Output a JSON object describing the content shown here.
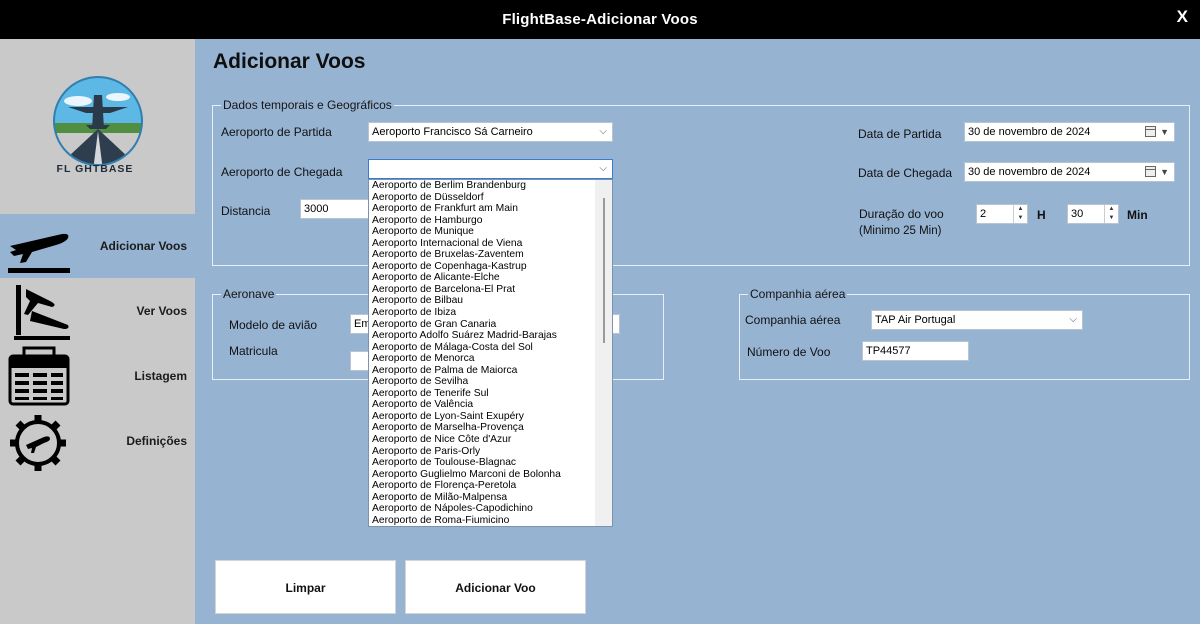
{
  "window": {
    "title": "FlightBase-Adicionar Voos",
    "close_label": "X"
  },
  "sidebar": {
    "logo_text": "FL GHTBASE",
    "items": [
      {
        "label": "Adicionar Voos",
        "icon": "airplane-takeoff-icon",
        "active": true
      },
      {
        "label": "Ver Voos",
        "icon": "airplane-landing-icon",
        "active": false
      },
      {
        "label": "Listagem",
        "icon": "departure-board-icon",
        "active": false
      },
      {
        "label": "Definições",
        "icon": "gear-airplane-icon",
        "active": false
      }
    ]
  },
  "page_title": "Adicionar Voos",
  "geo": {
    "legend": "Dados temporais e Geográficos",
    "departure_airport_label": "Aeroporto de Partida",
    "departure_airport_value": "Aeroporto Francisco Sá Carneiro",
    "arrival_airport_label": "Aeroporto de Chegada",
    "arrival_airport_value": "",
    "distance_label": "Distancia",
    "distance_value": "3000",
    "departure_date_label": "Data de Partida",
    "departure_date_value": "30 de novembro de 2024",
    "arrival_date_label": "Data de Chegada",
    "arrival_date_value": "30 de novembro de 2024",
    "duration_label": "Duração do voo",
    "duration_hint": "(Minimo 25 Min)",
    "duration_hours": "2",
    "hours_unit": "H",
    "duration_minutes": "30",
    "minutes_unit": "Min"
  },
  "aircraft": {
    "legend": "Aeronave",
    "model_label": "Modelo de avião",
    "model_value": "Em",
    "registration_label": "Matricula",
    "registration_value": ""
  },
  "airline": {
    "legend": "Companhia aérea",
    "airline_label": "Companhia aérea",
    "airline_value": "TAP Air Portugal",
    "flight_number_label": "Número de Voo",
    "flight_number_value": "TP44577"
  },
  "dropdown_options": [
    "Aeroporto de Berlim Brandenburg",
    "Aeroporto de Düsseldorf",
    "Aeroporto de Frankfurt am Main",
    "Aeroporto de Hamburgo",
    "Aeroporto de Munique",
    "Aeroporto Internacional de Viena",
    "Aeroporto de Bruxelas-Zaventem",
    "Aeroporto de Copenhaga-Kastrup",
    "Aeroporto de Alicante-Elche",
    "Aeroporto de Barcelona-El Prat",
    "Aeroporto de Bilbau",
    "Aeroporto de Ibiza",
    "Aeroporto de Gran Canaria",
    "Aeroporto Adolfo Suárez Madrid-Barajas",
    "Aeroporto de Málaga-Costa del Sol",
    "Aeroporto de Menorca",
    "Aeroporto de Palma de Maiorca",
    "Aeroporto de Sevilha",
    "Aeroporto de Tenerife Sul",
    "Aeroporto de Valência",
    "Aeroporto de Lyon-Saint Exupéry",
    "Aeroporto de Marselha-Provença",
    "Aeroporto de Nice Côte d'Azur",
    "Aeroporto de Paris-Orly",
    "Aeroporto de Toulouse-Blagnac",
    "Aeroporto Guglielmo Marconi de Bolonha",
    "Aeroporto de Florença-Peretola",
    "Aeroporto de Milão-Malpensa",
    "Aeroporto de Nápoles-Capodichino",
    "Aeroporto de Roma-Fiumicino"
  ],
  "buttons": {
    "clear": "Limpar",
    "add_flight": "Adicionar Voo"
  },
  "colors": {
    "background": "#96b3d2",
    "sidebar": "#c9c9c9",
    "titlebar": "#000000"
  }
}
